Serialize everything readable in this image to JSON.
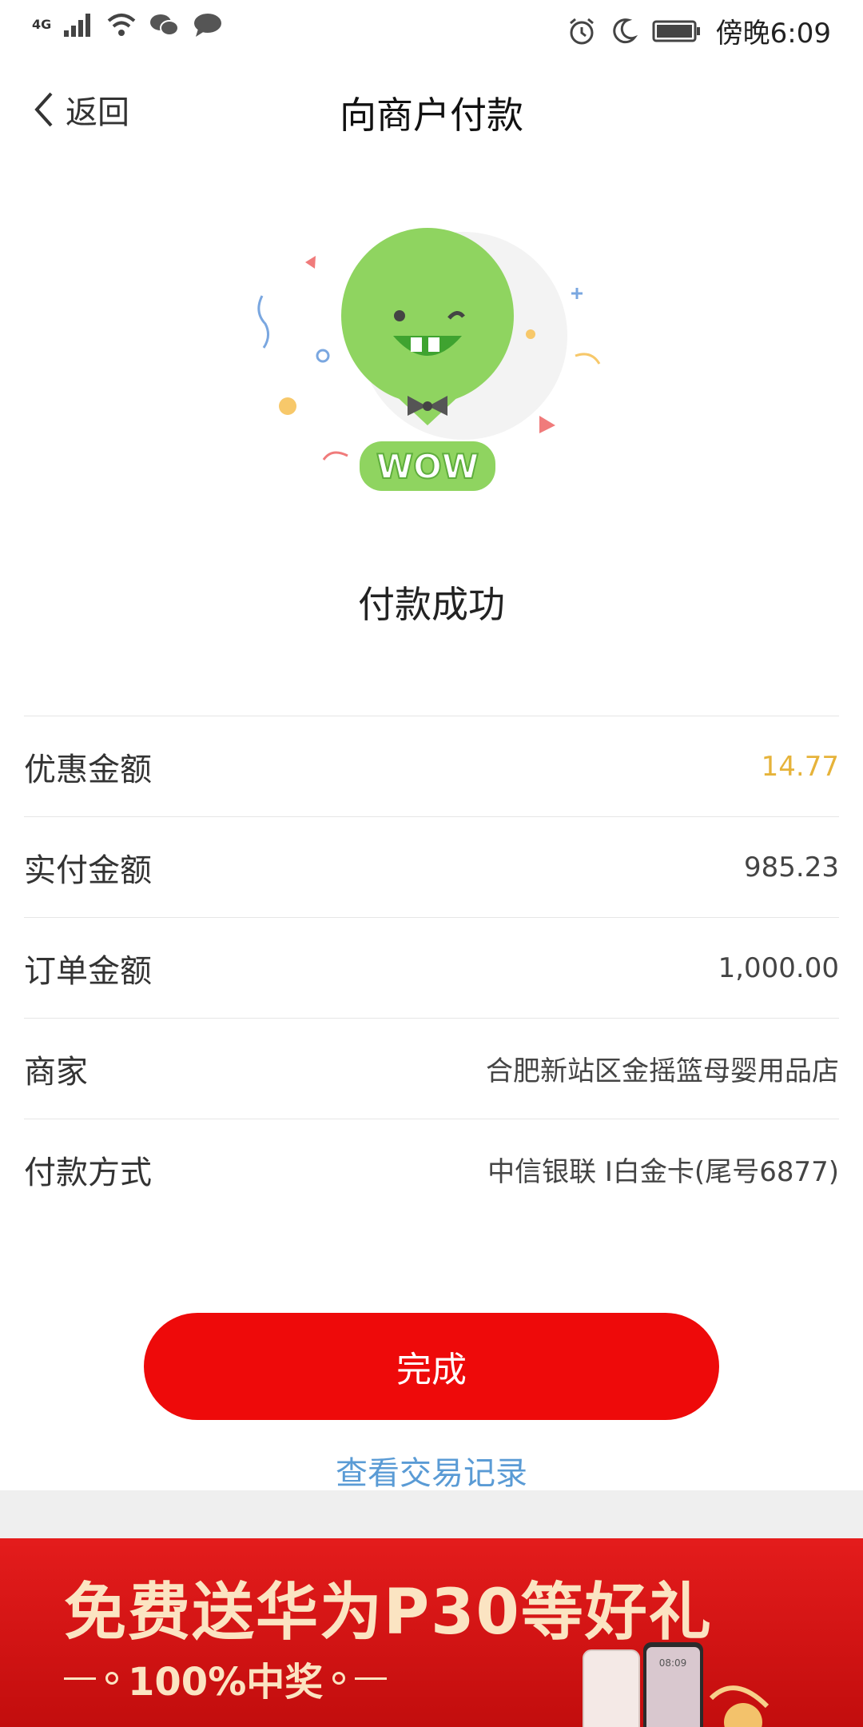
{
  "status_bar": {
    "network": "4G",
    "time": "傍晚6:09"
  },
  "header": {
    "back_label": "返回",
    "title": "向商户付款"
  },
  "illustration": {
    "badge_text": "WOW"
  },
  "result": {
    "message": "付款成功"
  },
  "details": [
    {
      "label": "优惠金额",
      "value": "14.77"
    },
    {
      "label": "实付金额",
      "value": "985.23"
    },
    {
      "label": "订单金额",
      "value": "1,000.00"
    },
    {
      "label": "商家",
      "value": "合肥新站区金摇篮母婴用品店"
    },
    {
      "label": "付款方式",
      "value": "中信银联 I白金卡(尾号6877)"
    }
  ],
  "actions": {
    "done_label": "完成",
    "records_label": "查看交易记录"
  },
  "banner": {
    "title": "免费送华为P30等好礼",
    "subtitle": "100%中奖",
    "phone_time": "08:09"
  },
  "colors": {
    "accent_yellow": "#e6b33a",
    "button_red": "#ee0a0a",
    "link_blue": "#5a9bd5",
    "mascot_green": "#8fd460"
  }
}
